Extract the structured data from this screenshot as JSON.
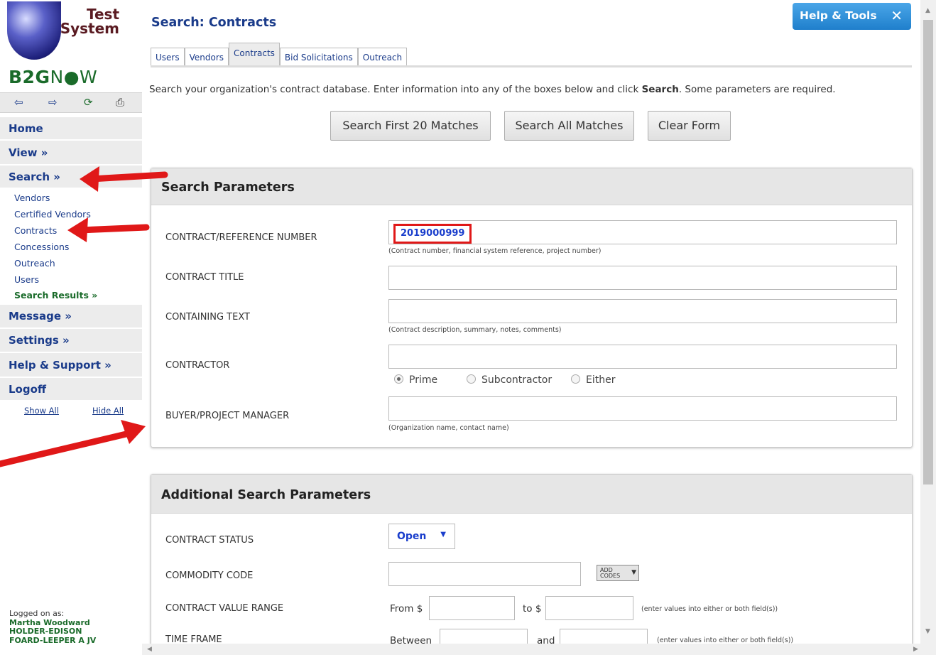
{
  "sidebar": {
    "logo": {
      "line1": "Test",
      "line2": "System",
      "brand_b2g": "B2G",
      "brand_now": "N",
      "brand_now2": "W"
    },
    "toolbar": {
      "back": "⇦",
      "forward": "⇨",
      "refresh": "⟳",
      "print": "⎙"
    },
    "nav": {
      "home": "Home",
      "view": "View »",
      "search": "Search »",
      "message": "Message »",
      "settings": "Settings »",
      "help": "Help & Support »",
      "logoff": "Logoff"
    },
    "search_sub": [
      "Vendors",
      "Certified Vendors",
      "Contracts",
      "Concessions",
      "Outreach",
      "Users",
      "Search Results »"
    ],
    "show_all": "Show All",
    "hide_all": "Hide All",
    "logged_label": "Logged on as:",
    "logged_user": "Martha Woodward",
    "logged_org1": "HOLDER-EDISON",
    "logged_org2": "FOARD-LEEPER A JV"
  },
  "main": {
    "title": "Search: Contracts",
    "help_tools": "Help & Tools",
    "tabs": [
      "Users",
      "Vendors",
      "Contracts",
      "Bid Solicitations",
      "Outreach"
    ],
    "intro_pre": "Search your organization's contract database. Enter information into any of the boxes below and click ",
    "intro_bold": "Search",
    "intro_post": ". Some parameters are required.",
    "buttons": {
      "first20": "Search First 20 Matches",
      "all": "Search All Matches",
      "clear": "Clear Form"
    },
    "search_params": {
      "header": "Search Parameters",
      "contract_number_label": "CONTRACT/REFERENCE NUMBER",
      "contract_number_value": "2019000999",
      "contract_number_hint": "(Contract number, financial system reference, project number)",
      "contract_title_label": "CONTRACT TITLE",
      "containing_text_label": "CONTAINING TEXT",
      "containing_text_hint": "(Contract description, summary, notes, comments)",
      "contractor_label": "CONTRACTOR",
      "radio_prime": "Prime",
      "radio_sub": "Subcontractor",
      "radio_either": "Either",
      "buyer_label": "BUYER/PROJECT MANAGER",
      "buyer_hint": "(Organization name, contact name)"
    },
    "additional_params": {
      "header": "Additional Search Parameters",
      "status_label": "CONTRACT STATUS",
      "status_value": "Open",
      "commodity_label": "COMMODITY CODE",
      "add_codes_1": "ADD",
      "add_codes_2": "CODES",
      "value_range_label": "CONTRACT VALUE RANGE",
      "from_label": "From $",
      "to_label": "to $",
      "value_hint": "(enter values into either or both field(s))",
      "time_frame_label": "TIME FRAME",
      "between_label": "Between",
      "and_label": "and",
      "time_hint": "(enter values into either or both field(s))"
    }
  },
  "colors": {
    "link_blue": "#1a3b8a",
    "brand_green": "#1a6b2a",
    "highlight_red": "#e01818",
    "help_blue": "#2a8ad8"
  }
}
